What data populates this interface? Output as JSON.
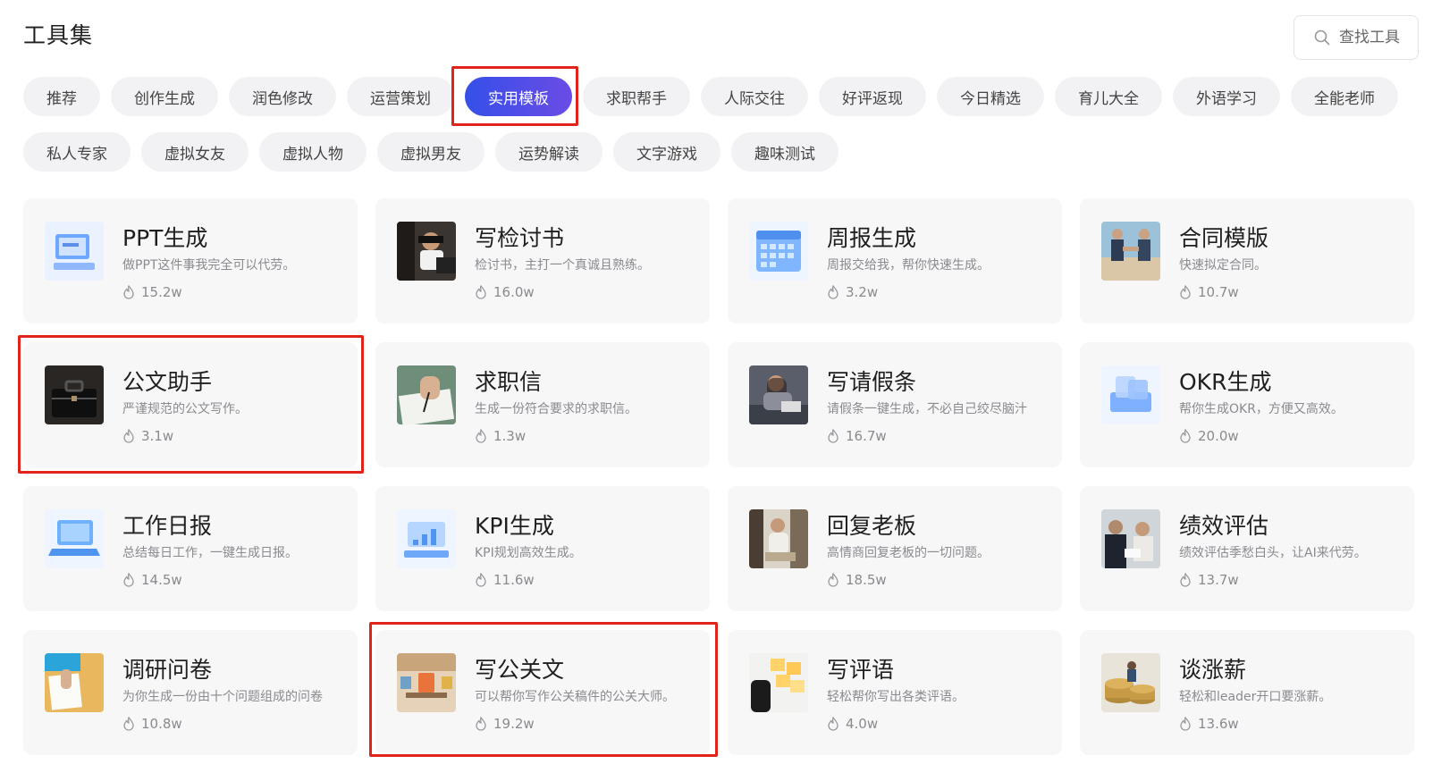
{
  "header": {
    "title": "工具集",
    "search_placeholder": "查找工具"
  },
  "categories_row1": [
    {
      "label": "推荐",
      "active": false
    },
    {
      "label": "创作生成",
      "active": false
    },
    {
      "label": "润色修改",
      "active": false
    },
    {
      "label": "运营策划",
      "active": false
    },
    {
      "label": "实用模板",
      "active": true
    },
    {
      "label": "求职帮手",
      "active": false
    },
    {
      "label": "人际交往",
      "active": false
    },
    {
      "label": "好评返现",
      "active": false
    },
    {
      "label": "今日精选",
      "active": false
    },
    {
      "label": "育儿大全",
      "active": false
    },
    {
      "label": "外语学习",
      "active": false
    },
    {
      "label": "全能老师",
      "active": false
    }
  ],
  "categories_row2": [
    {
      "label": "私人专家"
    },
    {
      "label": "虚拟女友"
    },
    {
      "label": "虚拟人物"
    },
    {
      "label": "虚拟男友"
    },
    {
      "label": "运势解读"
    },
    {
      "label": "文字游戏"
    },
    {
      "label": "趣味测试"
    }
  ],
  "tools": [
    {
      "title": "PPT生成",
      "desc": "做PPT这件事我完全可以代劳。",
      "count": "15.2w",
      "icon": "ppt-thumbnail-icon"
    },
    {
      "title": "写检讨书",
      "desc": "检讨书，主打一个真诚且熟练。",
      "count": "16.0w",
      "icon": "person-at-laptop-thumbnail"
    },
    {
      "title": "周报生成",
      "desc": "周报交给我，帮你快速生成。",
      "count": "3.2w",
      "icon": "calendar-thumbnail-icon"
    },
    {
      "title": "合同模版",
      "desc": "快速拟定合同。",
      "count": "10.7w",
      "icon": "handshake-thumbnail"
    },
    {
      "title": "公文助手",
      "desc": "严谨规范的公文写作。",
      "count": "3.1w",
      "icon": "briefcase-thumbnail"
    },
    {
      "title": "求职信",
      "desc": "生成一份符合要求的求职信。",
      "count": "1.3w",
      "icon": "writing-hand-thumbnail"
    },
    {
      "title": "写请假条",
      "desc": "请假条一键生成，不必自己绞尽脑汁",
      "count": "16.7w",
      "icon": "resting-woman-thumbnail"
    },
    {
      "title": "OKR生成",
      "desc": "帮你生成OKR，方便又高效。",
      "count": "20.0w",
      "icon": "okr-thumbnail-icon"
    },
    {
      "title": "工作日报",
      "desc": "总结每日工作，一键生成日报。",
      "count": "14.5w",
      "icon": "laptop-thumbnail-icon"
    },
    {
      "title": "KPI生成",
      "desc": "KPI规划高效生成。",
      "count": "11.6w",
      "icon": "kpi-thumbnail-icon"
    },
    {
      "title": "回复老板",
      "desc": "高情商回复老板的一切问题。",
      "count": "18.5w",
      "icon": "woman-on-sofa-thumbnail"
    },
    {
      "title": "绩效评估",
      "desc": "绩效评估季愁白头，让AI来代劳。",
      "count": "13.7w",
      "icon": "meeting-thumbnail"
    },
    {
      "title": "调研问卷",
      "desc": "为你生成一份由十个问题组成的问卷",
      "count": "10.8w",
      "icon": "questionnaire-thumbnail"
    },
    {
      "title": "写公关文",
      "desc": "可以帮你写作公关稿件的公关大师。",
      "count": "19.2w",
      "icon": "office-desk-thumbnail"
    },
    {
      "title": "写评语",
      "desc": "轻松帮你写出各类评语。",
      "count": "4.0w",
      "icon": "sticky-notes-thumbnail"
    },
    {
      "title": "谈涨薪",
      "desc": "轻松和leader开口要涨薪。",
      "count": "13.6w",
      "icon": "coins-thumbnail"
    }
  ],
  "colors": {
    "accent_start": "#3450e8",
    "accent_end": "#6c4be6",
    "highlight": "#e0241b",
    "card_bg": "#f7f7f8",
    "tag_bg": "#f2f2f4"
  }
}
